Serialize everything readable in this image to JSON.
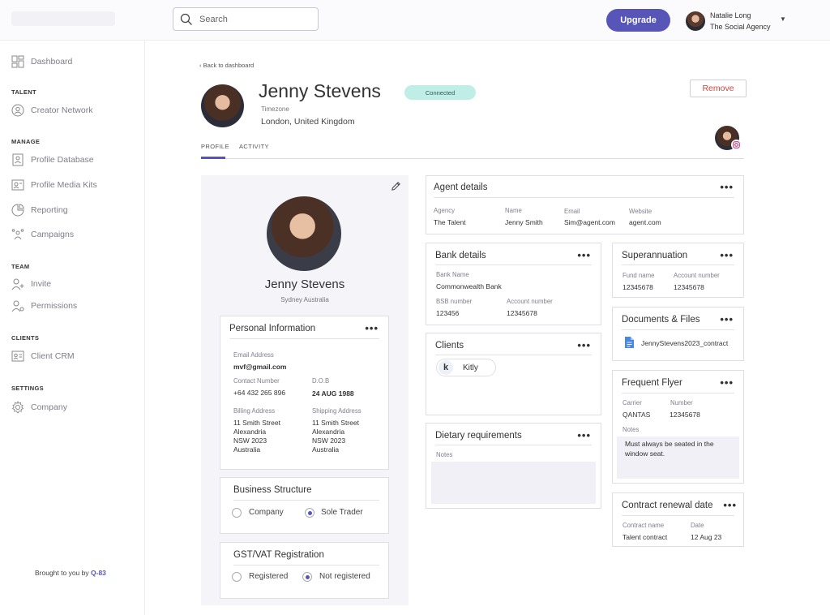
{
  "topbar": {
    "search_placeholder": "Search",
    "upgrade_label": "Upgrade",
    "user_name": "Natalie Long",
    "user_org": "The Social Agency"
  },
  "sidebar": {
    "dashboard": "Dashboard",
    "sections": {
      "talent": "TALENT",
      "manage": "MANAGE",
      "team": "TEAM",
      "clients": "CLIENTS",
      "settings": "SETTINGS"
    },
    "items": {
      "creator_network": "Creator Network",
      "profile_database": "Profile Database",
      "profile_media_kits": "Profile Media Kits",
      "reporting": "Reporting",
      "campaigns": "Campaigns",
      "invite": "Invite",
      "permissions": "Permissions",
      "client_crm": "Client CRM",
      "company": "Company"
    },
    "brought_prefix": "Brought to you by",
    "brought_brand": "Q-83"
  },
  "header": {
    "back_link": "‹  Back to dashboard",
    "name": "Jenny Stevens",
    "timezone_label": "Timezone",
    "timezone_value": "London, United Kingdom",
    "status": "Connected",
    "remove_label": "Remove",
    "tabs": [
      "PROFILE",
      "ACTIVITY"
    ]
  },
  "profile": {
    "name": "Jenny Stevens",
    "location": "Sydney Australia"
  },
  "personal_info": {
    "title": "Personal Information",
    "email_label": "Email Address",
    "email": "mvf@gmail.com",
    "contact_label": "Contact Number",
    "contact": "+64 432 265 896",
    "dob_label": "D.O.B",
    "dob": "24 AUG 1988",
    "billing_label": "Billing Address",
    "billing_lines": [
      "11 Smith Street",
      "Alexandria",
      "NSW 2023",
      "Australia"
    ],
    "shipping_label": "Shipping Address",
    "shipping_lines": [
      "11 Smith Street",
      "Alexandria",
      "NSW 2023",
      "Australia"
    ]
  },
  "business_structure": {
    "title": "Business Structure",
    "options": [
      "Company",
      "Sole Trader"
    ],
    "selected": "Sole Trader"
  },
  "gst": {
    "title": "GST/VAT Registration",
    "options": [
      "Registered",
      "Not registered"
    ],
    "selected": "Not registered"
  },
  "agent": {
    "title": "Agent details",
    "agency_label": "Agency",
    "agency": "The Talent",
    "name_label": "Name",
    "name": "Jenny Smith",
    "email_label": "Email",
    "email": "Sim@agent.com",
    "website_label": "Website",
    "website": "agent.com"
  },
  "bank": {
    "title": "Bank details",
    "bank_name_label": "Bank Name",
    "bank_name": "Commonwealth Bank",
    "bsb_label": "BSB number",
    "bsb": "123456",
    "account_label": "Account number",
    "account": "12345678"
  },
  "super": {
    "title": "Superannuation",
    "fund_label": "Fund name",
    "fund": "12345678",
    "account_label": "Account number",
    "account": "12345678"
  },
  "clients": {
    "title": "Clients",
    "initial": "k",
    "client": "Kitly"
  },
  "documents": {
    "title": "Documents & Files",
    "file": "JennyStevens2023_contract"
  },
  "dietary": {
    "title": "Dietary requirements",
    "notes_label": "Notes"
  },
  "flyer": {
    "title": "Frequent Flyer",
    "carrier_label": "Carrier",
    "carrier": "QANTAS",
    "number_label": "Number",
    "number": "12345678",
    "notes_label": "Notes",
    "notes": "Must always be seated in the window seat."
  },
  "contract": {
    "title": "Contract renewal date",
    "name_label": "Contract name",
    "name": "Talent contract",
    "date_label": "Date",
    "date": "12 Aug 23"
  },
  "dots": "•••",
  "colors": {
    "accent": "#5855b8",
    "connected_bg": "#bfeee6",
    "remove_text": "#d0453f"
  }
}
